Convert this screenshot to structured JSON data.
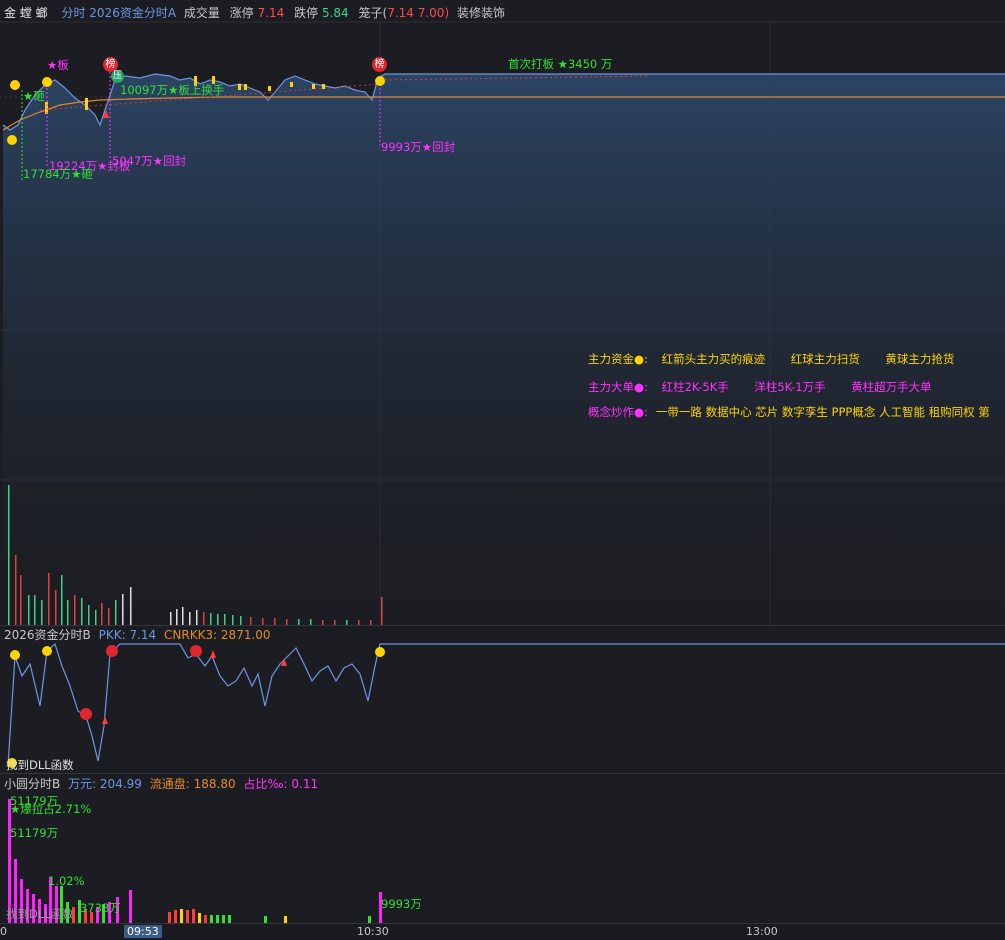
{
  "header": {
    "stock_name": "金 螳 螂",
    "indicator": "分时 2026资金分时A",
    "volume_label": "成交量",
    "limit_up_label": "涨停",
    "limit_up_value": "7.14",
    "limit_down_label": "跌停",
    "limit_down_value": "5.84",
    "cage_label": "笼子(",
    "cage_value": "7.14 7.00)",
    "sector": "装修装饰"
  },
  "main_chart": {
    "first_board": "首次打板 ★3450 万",
    "ann_board": "★板",
    "ann_smash": "★砸",
    "ann_turnover": "10097万★板上换手",
    "ann_seal1": "19224万★封板",
    "ann_reseal1": "5047万★回封",
    "ann_smash_amt": "17784万★砸",
    "ann_reseal2": "9993万★回封",
    "tag_bang": "榜",
    "tag_ya": "压"
  },
  "legend": {
    "row1_title": "主力资金●:",
    "row1_items": [
      "红箭头主力买的痕迹",
      "红球主力扫货",
      "黄球主力抢货"
    ],
    "row2_title": "主力大单●:",
    "row2_items": [
      "红柱2K-5K手",
      "洋柱5K-1万手",
      "黄柱超万手大单"
    ],
    "row3_title": "概念炒作●:",
    "row3_text": "一带一路 数据中心 芯片 数字孪生 PPP概念 人工智能 租购同权 第"
  },
  "pane_b": {
    "title": "2026资金分时B",
    "pkk_label": "PKK: 7.14",
    "cnrkk_label": "CNRKK3: 2871.00",
    "dll_note": "找到DLL函数"
  },
  "pane_c": {
    "title": "小圆分时B",
    "wan_label": "万元: 204.99",
    "float_label": "流通盘: 188.80",
    "ratio_label": "占比‰: 0.11",
    "ann1": "51179万",
    "ann2": "★爆拉占2.71%",
    "ann3": "51179万",
    "ann4": "1.02%",
    "ann5": "3738万",
    "ann6": "9993万",
    "dll_note": "找到DLL函数"
  },
  "time_axis": {
    "t0": "0",
    "t1": "09:53",
    "t2": "10:30",
    "t3": "13:00"
  },
  "colors": {
    "price_line": "#6f95e0",
    "avg_line": "#e08a2a",
    "yellow": "#ffd400",
    "magenta": "#ff33ff",
    "green": "#33e033",
    "red": "#ff3b3b"
  }
}
